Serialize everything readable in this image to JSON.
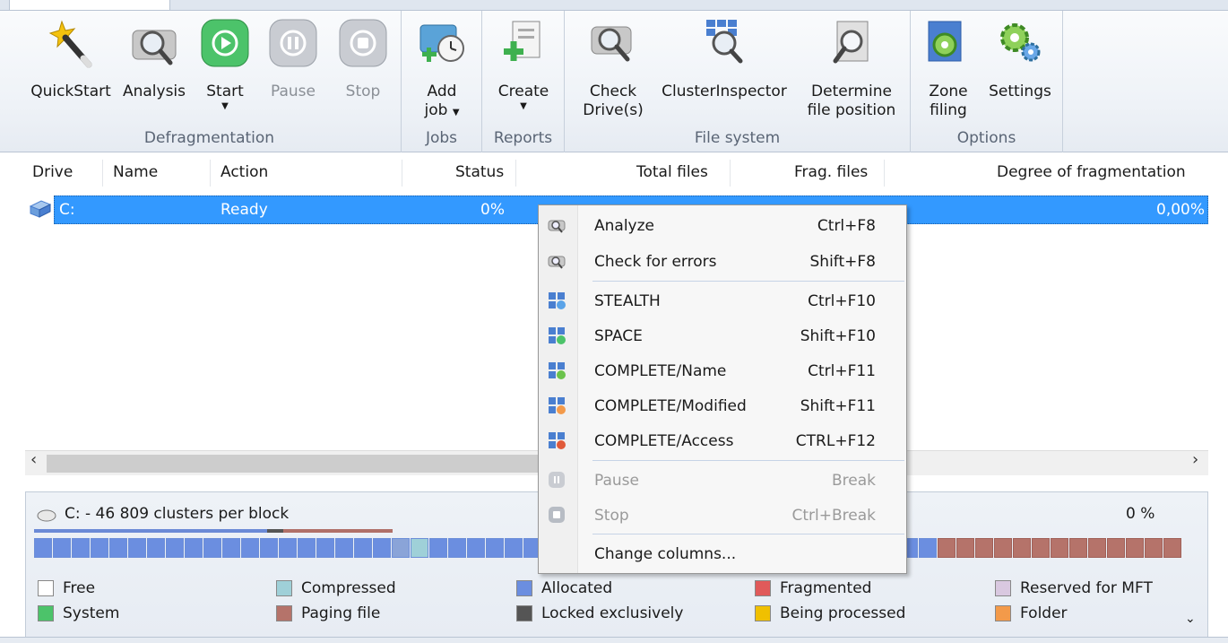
{
  "ribbon": {
    "groups": [
      {
        "label": "Defragmentation"
      },
      {
        "label": "Jobs"
      },
      {
        "label": "Reports"
      },
      {
        "label": "File system"
      },
      {
        "label": "Options"
      }
    ],
    "buttons": {
      "quickstart": "QuickStart",
      "analysis": "Analysis",
      "start": "Start",
      "pause": "Pause",
      "stop": "Stop",
      "add_job_1": "Add",
      "add_job_2": "job",
      "create": "Create",
      "check_drives_1": "Check",
      "check_drives_2": "Drive(s)",
      "cluster_inspector": "ClusterInspector",
      "determine_1": "Determine",
      "determine_2": "file position",
      "zone_1": "Zone",
      "zone_2": "filing",
      "settings": "Settings"
    }
  },
  "drive_list": {
    "columns": [
      "Drive",
      "Name",
      "Action",
      "Status",
      "Total files",
      "Frag. files",
      "Degree of fragmentation"
    ],
    "row": {
      "drive": "C:",
      "action": "Ready",
      "status": "0%",
      "degree": "0,00%"
    }
  },
  "map": {
    "title": "C: - 46 809 clusters per block",
    "percent": "0 %",
    "legend": [
      {
        "label": "Free",
        "color": "#ffffff"
      },
      {
        "label": "Compressed",
        "color": "#9fd0d8"
      },
      {
        "label": "Allocated",
        "color": "#6b8ee0"
      },
      {
        "label": "Fragmented",
        "color": "#e05a5a"
      },
      {
        "label": "Reserved for MFT",
        "color": "#d9c8e0"
      },
      {
        "label": "System",
        "color": "#4cc36a"
      },
      {
        "label": "Paging file",
        "color": "#b5736a"
      },
      {
        "label": "Locked exclusively",
        "color": "#555555"
      },
      {
        "label": "Being processed",
        "color": "#f0c000"
      },
      {
        "label": "Folder",
        "color": "#f39a4a"
      }
    ]
  },
  "context_menu": {
    "items": [
      {
        "label": "Analyze",
        "key": "Ctrl+F8"
      },
      {
        "label": "Check for errors",
        "key": "Shift+F8"
      },
      {
        "label": "STEALTH",
        "key": "Ctrl+F10"
      },
      {
        "label": "SPACE",
        "key": "Shift+F10"
      },
      {
        "label": "COMPLETE/Name",
        "key": "Ctrl+F11"
      },
      {
        "label": "COMPLETE/Modified",
        "key": "Shift+F11"
      },
      {
        "label": "COMPLETE/Access",
        "key": "CTRL+F12"
      },
      {
        "label": "Pause",
        "key": "Break"
      },
      {
        "label": "Stop",
        "key": "Ctrl+Break"
      },
      {
        "label": "Change columns...",
        "key": ""
      }
    ]
  },
  "colors": {
    "selection": "#3399ff",
    "ribbon_bg": "#eef2f7",
    "start_green": "#4cc36a"
  }
}
